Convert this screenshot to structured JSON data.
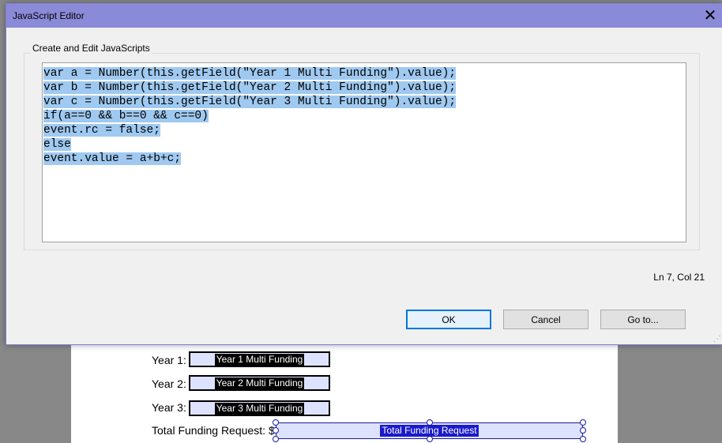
{
  "dialog": {
    "title": "JavaScript Editor",
    "group_label": "Create and Edit JavaScripts",
    "code_lines": [
      "var a = Number(this.getField(\"Year 1 Multi Funding\").value);",
      "var b = Number(this.getField(\"Year 2 Multi Funding\").value);",
      "var c = Number(this.getField(\"Year 3 Multi Funding\").value);",
      "if(a==0 && b==0 && c==0)",
      "event.rc = false;",
      "else",
      "event.value = a+b+c;"
    ],
    "status": "Ln 7, Col 21",
    "buttons": {
      "ok": "OK",
      "cancel": "Cancel",
      "goto": "Go to..."
    }
  },
  "form": {
    "year1_label": "Year 1:",
    "year1_field": "Year 1 Multi Funding",
    "year2_label": "Year 2:",
    "year2_field": "Year 2 Multi Funding",
    "year3_label": "Year 3:",
    "year3_field": "Year 3 Multi Funding",
    "total_label": "Total Funding Request:",
    "currency": "$",
    "total_field": "Total Funding Request"
  },
  "colors": {
    "titlebar": "#8a8ad8",
    "selection": "#9fc9f0",
    "field_fill": "#dde3ff"
  }
}
